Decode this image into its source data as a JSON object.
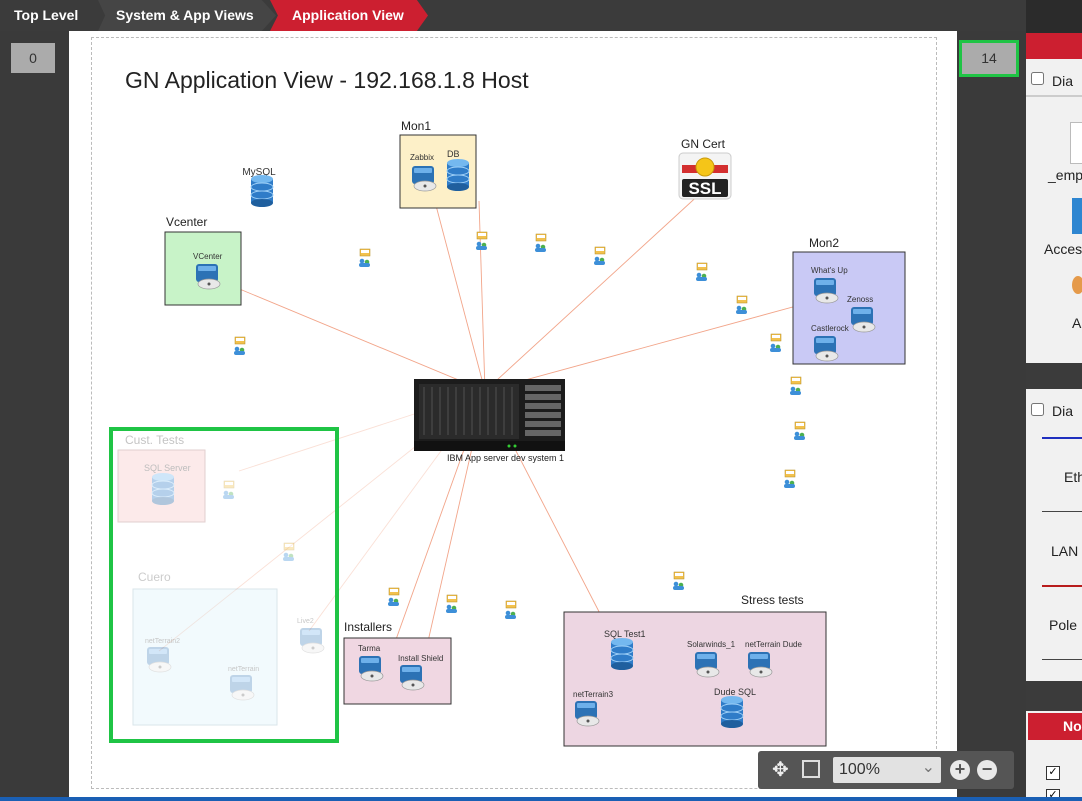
{
  "breadcrumb": {
    "items": [
      "Top Level",
      "System & App Views",
      "Application View"
    ]
  },
  "left_badge": "0",
  "right_badge": "14",
  "diagram": {
    "title": "GN Application View - 192.168.1.8 Host",
    "center_label": "IBM App server dev system 1",
    "groups": {
      "mon1": "Mon1",
      "vcenter": "Vcenter",
      "mon2": "Mon2",
      "installers": "Installers",
      "stress": "Stress tests",
      "cust": "Cust. Tests",
      "cuero": "Cuero"
    },
    "nodes": {
      "mysql": "MySQL",
      "zabbix": "Zabbix",
      "db": "DB",
      "vcenter": "VCenter",
      "gncert": "GN Cert",
      "ssl": "SSL",
      "whatsup": "What's Up",
      "zenoss": "Zenoss",
      "castlerock": "Castlerock",
      "sqlserver": "SQL Server",
      "netterrain2": "netTerrain2",
      "netterrain": "netTerrain",
      "live2": "Live2",
      "tarma": "Tarma",
      "installshield": "Install Shield",
      "sqltest1": "SQL Test1",
      "solarwinds": "Solarwinds_1",
      "dude": "netTerrain Dude",
      "dudesql": "Dude SQL",
      "netterrain3": "netTerrain3"
    }
  },
  "zoom": {
    "level": "100%"
  },
  "side_panel": {
    "labels": [
      "Dia",
      "_emp",
      "Acces",
      "A",
      "Dia",
      "Eth",
      "LAN",
      "Pole",
      "No"
    ]
  },
  "colors": {
    "accent": "#cc1f30",
    "highlight": "#1fc445",
    "link": "#f2a58a"
  }
}
